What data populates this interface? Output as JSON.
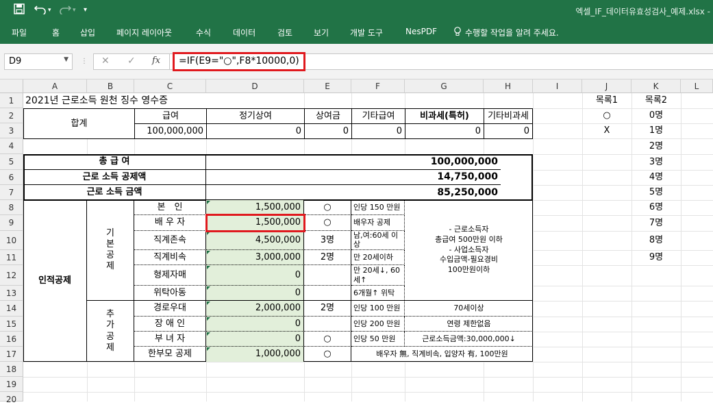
{
  "app": {
    "title": "엑셀_IF_데이터유효성검사_예제.xlsx -",
    "qa": {
      "save_icon": "save-icon",
      "undo_icon": "undo-icon",
      "redo_icon": "redo-icon",
      "more": "▾"
    }
  },
  "ribbon": {
    "tabs": [
      "파일",
      "홈",
      "삽입",
      "페이지 레이아웃",
      "수식",
      "데이터",
      "검토",
      "보기",
      "개발 도구",
      "NesPDF"
    ],
    "tell_me": "수행할 작업을 알려 주세요."
  },
  "formula_bar": {
    "name_box": "D9",
    "cancel": "✕",
    "enter": "✓",
    "fx": "fx",
    "formula": "=IF(E9=\"○\",F8*10000,0)"
  },
  "columns": [
    "A",
    "B",
    "C",
    "D",
    "E",
    "F",
    "G",
    "H",
    "I",
    "J",
    "K",
    "L"
  ],
  "rows": [
    "1",
    "2",
    "3",
    "4",
    "5",
    "6",
    "7",
    "8",
    "9",
    "10",
    "11",
    "12",
    "13",
    "14",
    "15",
    "16",
    "17",
    "18",
    "19",
    "20"
  ],
  "sheet": {
    "title": "2021년 근로소득 원천 징수 영수증",
    "total_label": "합계",
    "hdr": {
      "salary": "급여",
      "regular": "정기상여",
      "bonus": "상여금",
      "other": "기타급여",
      "nontax": "비과세(특허)",
      "other_nontax": "기타비과세"
    },
    "row3": {
      "salary": "100,000,000",
      "regular": "0",
      "bonus": "0",
      "other": "0",
      "nontax": "0",
      "other_nontax": "0"
    },
    "summary": [
      {
        "label": "총 급 여",
        "value": "100,000,000"
      },
      {
        "label": "근로 소득 공제액",
        "value": "14,750,000"
      },
      {
        "label": "근로 소득 금액",
        "value": "85,250,000"
      }
    ],
    "personal": "인적공제",
    "basic": "기\n본\n공\n제",
    "extra": "추\n가\n공\n제",
    "items": [
      {
        "name": "본　인",
        "amount": "1,500,000",
        "cnt": "○",
        "note": "인당 150 만원"
      },
      {
        "name": "배 우 자",
        "amount": "1,500,000",
        "cnt": "○",
        "note": "배우자 공제"
      },
      {
        "name": "직계존속",
        "amount": "4,500,000",
        "cnt": "3명",
        "note": "남,여:60세 이상"
      },
      {
        "name": "직계비속",
        "amount": "3,000,000",
        "cnt": "2명",
        "note": "만 20세이하"
      },
      {
        "name": "형제자매",
        "amount": "0",
        "cnt": "",
        "note": "만 20세↓, 60세↑"
      },
      {
        "name": "위탁아동",
        "amount": "0",
        "cnt": "",
        "note": "6개월↑ 위탁"
      },
      {
        "name": "경로우대",
        "amount": "2,000,000",
        "cnt": "2명",
        "note": "인당 100 만원"
      },
      {
        "name": "장 애 인",
        "amount": "0",
        "cnt": "",
        "note": "인당 200 만원"
      },
      {
        "name": "부 녀 자",
        "amount": "0",
        "cnt": "○",
        "note": "인당 50 만원"
      },
      {
        "name": "한부모 공제",
        "amount": "1,000,000",
        "cnt": "○",
        "note": ""
      }
    ],
    "g_basic": "- 근로소득자\n총급여 500만원 이하\n- 사업소득자\n수입금액-필요경비\n100만원이하",
    "g14": "70세이상",
    "g15": "연령 제한없음",
    "g16": "근로소득금액:30,000,000↓",
    "fg17": "배우자 無, 직계비속, 입양자 有, 100만원",
    "list1_title": "목록1",
    "list1": [
      "○",
      "X"
    ],
    "list2_title": "목록2",
    "list2": [
      "0명",
      "1명",
      "2명",
      "3명",
      "4명",
      "5명",
      "6명",
      "7명",
      "8명",
      "9명"
    ]
  }
}
